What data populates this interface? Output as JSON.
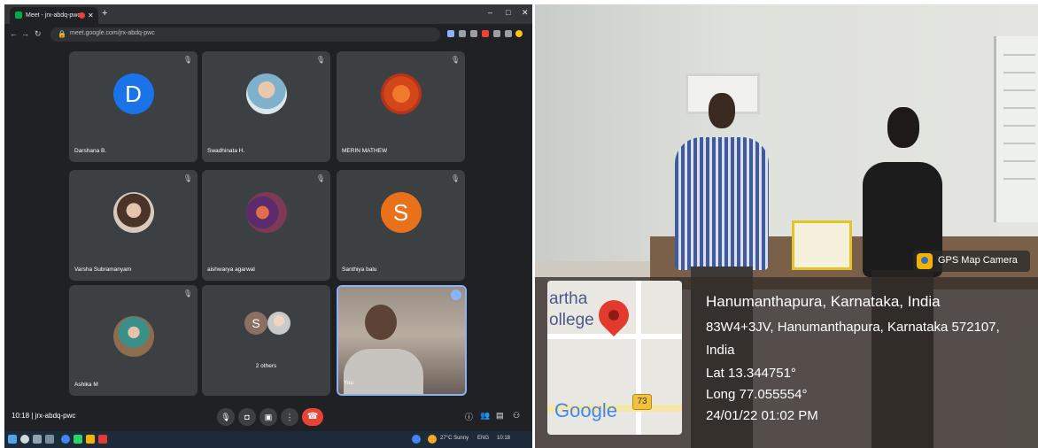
{
  "browser": {
    "tab_title": "Meet - jrx-abdq-pwc",
    "url": "meet.google.com/jrx-abdq-pwc"
  },
  "meet": {
    "participants": [
      {
        "name": "Darshana B.",
        "avatar_letter": "D",
        "avatar_color": "#1a73e8"
      },
      {
        "name": "Swadhinata H.",
        "avatar_letter": "",
        "avatar_color": "#dbe7ee"
      },
      {
        "name": "MERIN MATHEW",
        "avatar_letter": "",
        "avatar_color": "#e0561c"
      },
      {
        "name": "Varsha Subramanyam",
        "avatar_letter": "",
        "avatar_color": "#d8c9bd"
      },
      {
        "name": "aishwarya agarwal",
        "avatar_letter": "",
        "avatar_color": "#7d3a55"
      },
      {
        "name": "Santhiya balu",
        "avatar_letter": "S",
        "avatar_color": "#e8711a"
      },
      {
        "name": "Ashika M",
        "avatar_letter": "",
        "avatar_color": "#8e6d4e"
      },
      {
        "name": "2 others",
        "avatar_letter": "S",
        "avatar_color": "#8d6e63"
      },
      {
        "name": "You",
        "avatar_letter": "",
        "avatar_color": ""
      }
    ],
    "time": "10:18",
    "meeting_code": "jrx-abdq-pwc"
  },
  "taskbar": {
    "weather": "27°C Sunny",
    "lang": "ENG",
    "clock": "10:18"
  },
  "gps": {
    "app_name": "GPS Map Camera",
    "map_label_1": "artha",
    "map_label_2": "ollege",
    "map_brand": "Google",
    "road_number": "73",
    "location_title": "Hanumanthapura, Karnataka, India",
    "address_line1": "83W4+3JV, Hanumanthapura, Karnataka 572107,",
    "address_line2": "India",
    "lat": "Lat 13.344751°",
    "long": "Long 77.055554°",
    "datetime": "24/01/22 01:02 PM"
  }
}
